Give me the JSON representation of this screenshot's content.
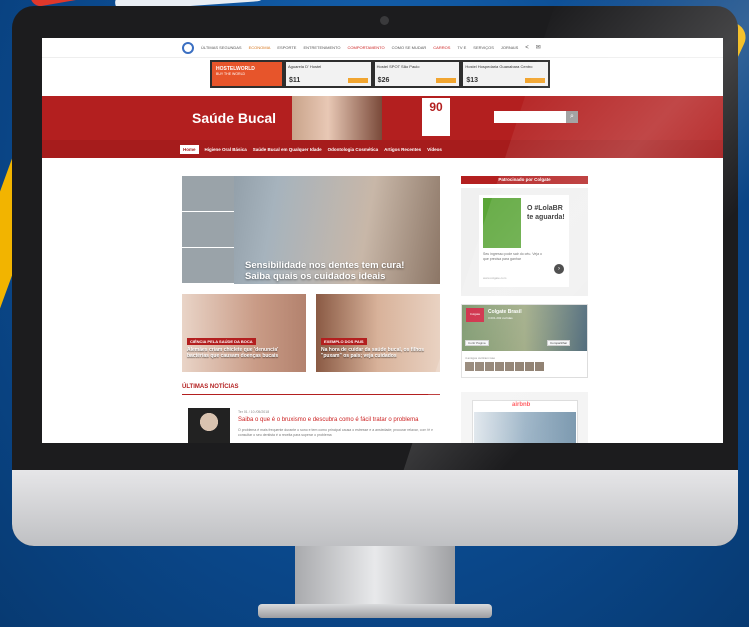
{
  "topnav": {
    "items": [
      "ÚLTIMAS SEGUNDAS",
      "ECONOMIA",
      "ESPORTE",
      "ENTRETENIMENTO",
      "COMPORTAMENTO",
      "COMO SE MUDAR",
      "CARROS",
      "TV E",
      "SERVIÇOS",
      "JORNAIS"
    ]
  },
  "ad": {
    "brand": "HOSTELWORLD",
    "tagline": "BUY THE WORLD",
    "offers": [
      {
        "name": "Aguarela D' Hostel",
        "price": "$11"
      },
      {
        "name": "Hostel SPOT São Paulo",
        "price": "$26"
      },
      {
        "name": "Hostel Hospedaria Guanabara Centro",
        "price": "$13"
      }
    ]
  },
  "site": {
    "title": "Saúde Bucal",
    "badge": "90"
  },
  "mainnav": {
    "items": [
      "Home",
      "Higiene Oral Básica",
      "Saúde Bucal em Qualquer Idade",
      "Odontologia Cosmética",
      "Artigos Recentes",
      "Vídeos"
    ]
  },
  "hero": {
    "caption_line1": "Sensibilidade nos dentes tem cura!",
    "caption_line2": "Saiba quais os cuidados ideais"
  },
  "cards": [
    {
      "tag": "CIÊNCIA PELA SAÚDE DA BOCA",
      "title": "Alemães criam chiclete que 'denuncia' bactérias que causam doenças bucais"
    },
    {
      "tag": "EXEMPLO DOS PAIS",
      "title": "Na hora de cuidar da saúde bucal, os filhos \"puxam\" os pais; veja cuidados"
    }
  ],
  "news": {
    "heading": "ÚLTIMAS NOTÍCIAS",
    "date": "Ter 01 / 10 /05/2018",
    "title": "Saiba o que é o bruxismo e descubra como é fácil tratar o problema",
    "body": "O problema é mais frequente durante o sono e tem como principal causa o estresse e a ansiedade; procurar relaxar, com fé e consultar o seu dentista é a receita para superar o problema"
  },
  "sidebar": {
    "sponsor_label": "Patrocinado por Colgate",
    "promo_text": "O #LolaBR te aguarda!",
    "promo_desc": "Seu ingresso pode sair do céu. Veja o que precisa para ganhar",
    "promo_url": "www.colgate.com",
    "fb_name": "Colgate Brasil",
    "fb_likes": "3.001.202 curtidas",
    "fb_like_btn": "Curtir Página",
    "fb_share_btn": "Compartilhar",
    "fb_friends": "4 amigos curtiram isso",
    "airbnb_label": "airbnb"
  }
}
